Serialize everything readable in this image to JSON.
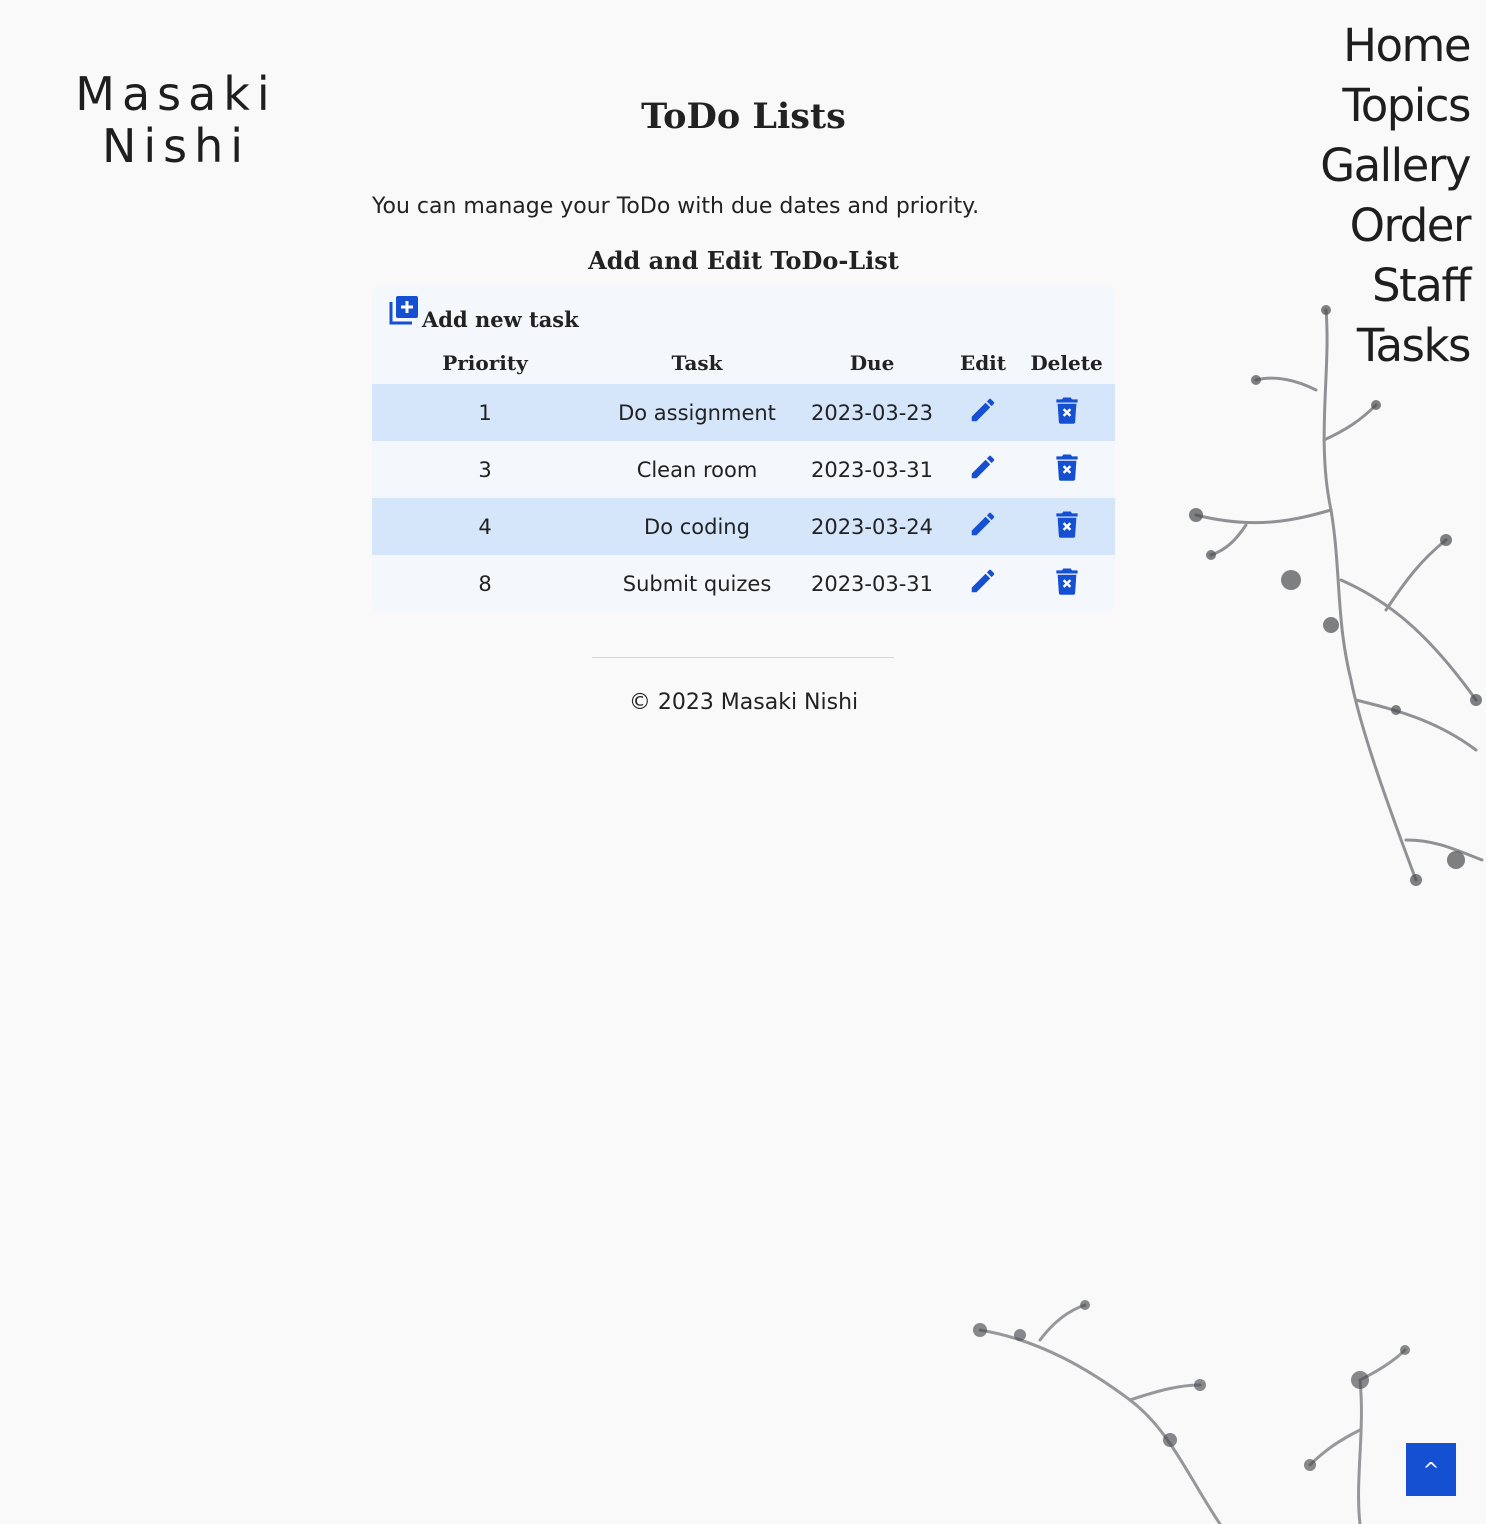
{
  "logo": {
    "line1": "Masaki",
    "line2": "Nishi"
  },
  "nav": {
    "items": [
      "Home",
      "Topics",
      "Gallery",
      "Order",
      "Staff",
      "Tasks"
    ]
  },
  "page": {
    "title": "ToDo Lists",
    "intro": "You can manage your ToDo with due dates and priority.",
    "section_title": "Add and Edit ToDo-List"
  },
  "add_task": {
    "label": "Add new task",
    "icon": "add-box-icon"
  },
  "table": {
    "headers": {
      "priority": "Priority",
      "task": "Task",
      "due": "Due",
      "edit": "Edit",
      "delete": "Delete"
    },
    "rows": [
      {
        "priority": "1",
        "task": "Do assignment",
        "due": "2023-03-23"
      },
      {
        "priority": "3",
        "task": "Clean room",
        "due": "2023-03-31"
      },
      {
        "priority": "4",
        "task": "Do coding",
        "due": "2023-03-24"
      },
      {
        "priority": "8",
        "task": "Submit quizes",
        "due": "2023-03-31"
      }
    ],
    "edit_icon": "pencil-icon",
    "delete_icon": "trash-icon"
  },
  "footer": {
    "text": "© 2023 Masaki Nishi"
  },
  "back_to_top": {
    "label": "^"
  },
  "colors": {
    "accent": "#1550d2",
    "row_highlight": "#d5e6fb",
    "card_bg": "#f4f7fb",
    "page_bg": "#f9f9fa",
    "text": "#222222"
  }
}
